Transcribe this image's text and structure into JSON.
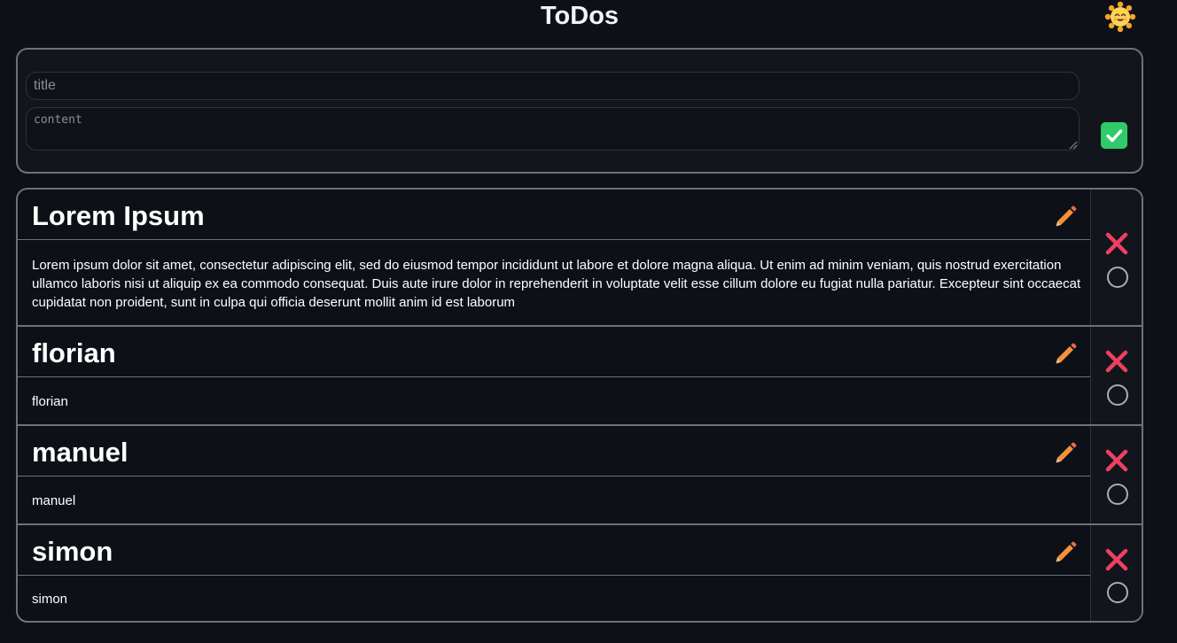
{
  "app": {
    "title": "ToDos",
    "theme_icon": "smiling-sun-icon"
  },
  "form": {
    "title_placeholder": "title",
    "content_placeholder": "content",
    "submit_icon": "checkmark-icon",
    "submit_color": "#2fcb6a"
  },
  "colors": {
    "background": "#0d1017",
    "border": "#6c717c",
    "delete": "#ef4060",
    "edit": "#f3913a"
  },
  "todos": [
    {
      "title": "Lorem Ipsum",
      "content": "Lorem ipsum dolor sit amet, consectetur adipiscing elit, sed do eiusmod tempor incididunt ut labore et dolore magna aliqua. Ut enim ad minim veniam, quis nostrud exercitation ullamco laboris nisi ut aliquip ex ea commodo consequat. Duis aute irure dolor in reprehenderit in voluptate velit esse cillum dolore eu fugiat nulla pariatur. Excepteur sint occaecat cupidatat non proident, sunt in culpa qui officia deserunt mollit anim id est laborum",
      "done": false
    },
    {
      "title": "florian",
      "content": "florian",
      "done": false
    },
    {
      "title": "manuel",
      "content": "manuel",
      "done": false
    },
    {
      "title": "simon",
      "content": "simon",
      "done": false
    }
  ]
}
